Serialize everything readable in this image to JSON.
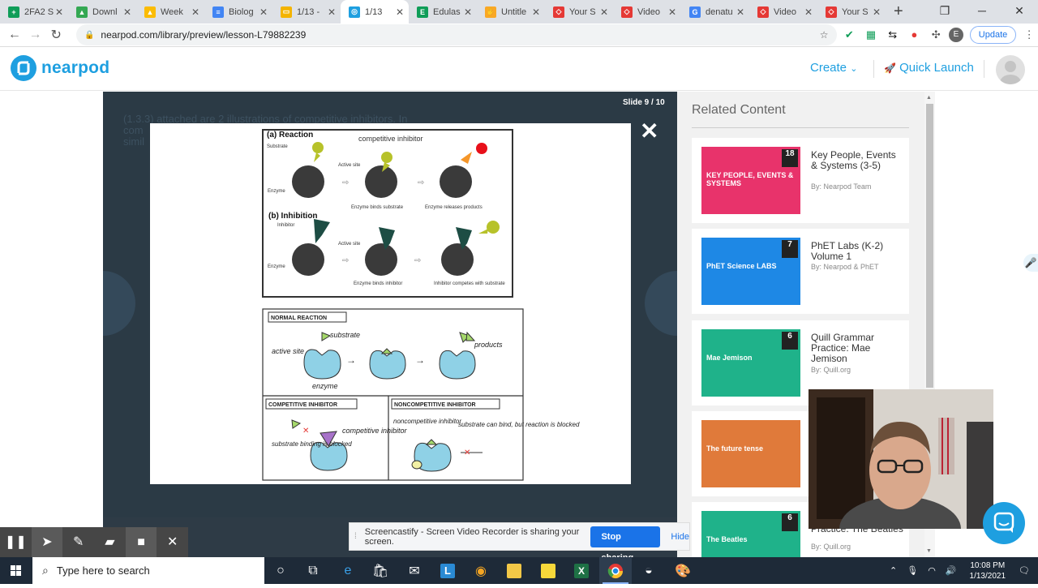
{
  "browser": {
    "tabs": [
      {
        "label": "2FA2 S",
        "color": "#0f9d58",
        "glyph": "+"
      },
      {
        "label": "Downl",
        "color": "#34a853",
        "glyph": "▲"
      },
      {
        "label": "Week",
        "color": "#fbbc04",
        "glyph": "▲"
      },
      {
        "label": "Biolog",
        "color": "#4285f4",
        "glyph": "≡"
      },
      {
        "label": "1/13 -",
        "color": "#f4b400",
        "glyph": "▭"
      },
      {
        "label": "1/13",
        "color": "#1e9fe0",
        "glyph": "◎"
      },
      {
        "label": "Edulas",
        "color": "#0f9d58",
        "glyph": "E"
      },
      {
        "label": "Untitle",
        "color": "#f9a825",
        "glyph": "✋"
      },
      {
        "label": "Your S",
        "color": "#e53935",
        "glyph": "◇"
      },
      {
        "label": "Video",
        "color": "#e53935",
        "glyph": "◇"
      },
      {
        "label": "denatu",
        "color": "#4285f4",
        "glyph": "G"
      },
      {
        "label": "Video",
        "color": "#e53935",
        "glyph": "◇"
      },
      {
        "label": "Your S",
        "color": "#e53935",
        "glyph": "◇"
      }
    ],
    "url": "nearpod.com/library/preview/lesson-L79882239",
    "update_label": "Update",
    "profile_initial": "E"
  },
  "nearpod": {
    "logo_text": "nearpod",
    "create_label": "Create",
    "quick_launch_label": "Quick Launch"
  },
  "viewer": {
    "slide_counter": "Slide 9 / 10",
    "background_text": "(1.3.3) attached are 2 illustrations of competitive inhibitors. In\ncom\nsimil",
    "slide": {
      "reaction_label": "(a) Reaction",
      "competitive_inhibitor_label": "competitive inhibitor",
      "substrate_label": "Substrate",
      "enzyme_label": "Enzyme",
      "active_site_label": "Active site",
      "binds_substrate_label": "Enzyme binds substrate",
      "releases_products_label": "Enzyme releases products",
      "inhibition_label": "(b) Inhibition",
      "inhibitor_label": "Inhibitor",
      "binds_inhibitor_label": "Enzyme binds inhibitor",
      "competes_label": "Inhibitor competes with substrate",
      "normal_reaction_label": "NORMAL REACTION",
      "hand_substrate": "substrate",
      "hand_active_site": "active site",
      "hand_enzyme": "enzyme",
      "hand_products": "products",
      "competitive_box_label": "COMPETITIVE INHIBITOR",
      "noncompetitive_box_label": "NONCOMPETITIVE INHIBITOR",
      "hand_competitive_inhibitor": "competitive inhibitor",
      "hand_substrate_blocked": "substrate binding is blocked",
      "hand_noncompetitive_inhibitor": "noncompetitive inhibitor",
      "hand_substrate_can_bind": "substrate can bind, but reaction is blocked"
    }
  },
  "related": {
    "title": "Related Content",
    "cards": [
      {
        "title": "Key People, Events & Systems (3-5)",
        "by": "By: Nearpod Team",
        "badge": "18",
        "thumb_color": "#e8336b",
        "thumb_text": "KEY PEOPLE, EVENTS & SYSTEMS"
      },
      {
        "title": "PhET Labs (K-2) Volume 1",
        "by": "By: Nearpod & PhET",
        "badge": "7",
        "thumb_color": "#1e88e5",
        "thumb_text": "PhET Science LABS"
      },
      {
        "title": "Quill Grammar Practice: Mae Jemison",
        "by": "By: Quill.org",
        "badge": "6",
        "thumb_color": "#1fb28a",
        "thumb_text": "Mae Jemison"
      },
      {
        "title": "",
        "by": "",
        "badge": "",
        "thumb_color": "#e07a3a",
        "thumb_text": "The future tense"
      },
      {
        "title": "Practice: The Beatles",
        "by": "By: Quill.org",
        "badge": "6",
        "thumb_color": "#1fb28a",
        "thumb_text": "The Beatles"
      }
    ]
  },
  "screencastify": {
    "share_message": "Screencastify - Screen Video Recorder is sharing your screen.",
    "stop_label": "Stop sharing",
    "hide_label": "Hide"
  },
  "taskbar": {
    "search_placeholder": "Type here to search",
    "time": "10:08 PM",
    "date": "1/13/2021"
  }
}
